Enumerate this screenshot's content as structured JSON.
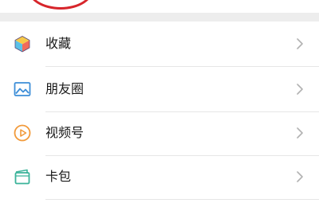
{
  "colors": {
    "annotation": "#d7252b",
    "text": "#191919",
    "chevron": "#b2b2b2",
    "divider": "#e6e6e6",
    "section_gap": "#ededed"
  },
  "menu": {
    "items": [
      {
        "label": "收藏",
        "icon": "favorites-cube-icon"
      },
      {
        "label": "朋友圈",
        "icon": "moments-picture-icon"
      },
      {
        "label": "视频号",
        "icon": "channels-play-icon"
      },
      {
        "label": "卡包",
        "icon": "card-wallet-icon"
      }
    ]
  }
}
